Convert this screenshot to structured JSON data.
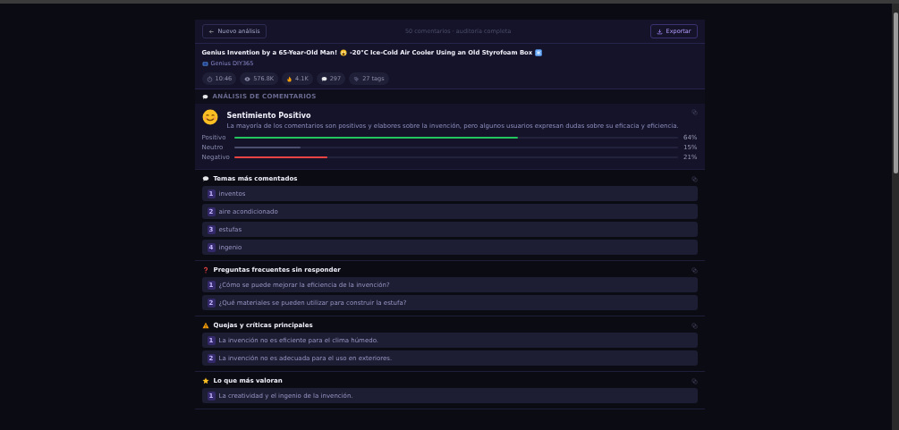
{
  "toolbar": {
    "back_button": "Nuevo análisis",
    "subtitle": "50 comentarios · auditoría completa",
    "export_button": "Exportar"
  },
  "video": {
    "title": [
      "Genius Invention by a 65-Year-Old Man!",
      "-20°C Ice-Cold Air Cooler Using an Old Styrofoam Box"
    ],
    "channel": "Genius DIY365",
    "stats": [
      {
        "kind": "duration",
        "text": "10:46"
      },
      {
        "kind": "views",
        "text": "576.8K"
      },
      {
        "kind": "likes",
        "text": "4.1K"
      },
      {
        "kind": "comments",
        "text": "297"
      },
      {
        "kind": "tags",
        "text": "27 tags"
      }
    ]
  },
  "section_label": "ANÁLISIS DE COMENTARIOS",
  "sentiment": {
    "title": "Sentimiento Positivo",
    "summary": "La mayoría de los comentarios son positivos y elabores sobre la invención, pero algunos usuarios expresan dudas sobre su eficacia y eficiencia.",
    "bars": [
      {
        "label": "Positivo",
        "level": 0.64,
        "reading": "64%",
        "color": "#22c55e"
      },
      {
        "label": "Neutro",
        "level": 0.15,
        "reading": "15%",
        "color": "#4b4e6d"
      },
      {
        "label": "Negativo",
        "level": 0.21,
        "reading": "21%",
        "color": "#ef4444"
      }
    ]
  },
  "sections": [
    {
      "kind": "topics",
      "title": "Temas más comentados",
      "items": [
        {
          "number": "1",
          "text": "inventos"
        },
        {
          "number": "2",
          "text": "aire acondicionado"
        },
        {
          "number": "3",
          "text": "estufas"
        },
        {
          "number": "4",
          "text": "ingenio"
        }
      ]
    },
    {
      "kind": "questions",
      "title": "Preguntas frecuentes sin responder",
      "items": [
        {
          "number": "1",
          "text": "¿Cómo se puede mejorar la eficiencia de la invención?"
        },
        {
          "number": "2",
          "text": "¿Qué materiales se pueden utilizar para construir la estufa?"
        }
      ]
    },
    {
      "kind": "complaints",
      "title": "Quejas y críticas principales",
      "items": [
        {
          "number": "1",
          "text": "La invención no es eficiente para el clima húmedo."
        },
        {
          "number": "2",
          "text": "La invención no es adecuada para el uso en exteriores."
        }
      ]
    },
    {
      "kind": "praise",
      "title": "Lo que más valoran",
      "items": [
        {
          "number": "1",
          "text": "La creatividad y el ingenio de la invención."
        }
      ]
    }
  ]
}
